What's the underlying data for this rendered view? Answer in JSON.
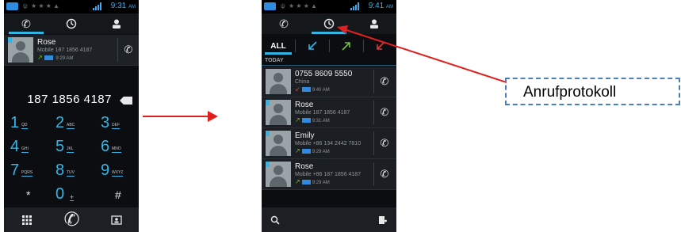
{
  "phone_dialer": {
    "status": {
      "time": "9:31",
      "ampm": "AM"
    },
    "tabs": [
      {
        "icon": "phone-icon",
        "selected": true
      },
      {
        "icon": "clock-icon",
        "selected": false
      },
      {
        "icon": "contacts-icon",
        "selected": false
      }
    ],
    "recent_contact": {
      "name": "Rose",
      "number": "Mobile 187 1856 4187",
      "time": "9:29 AM",
      "direction": "outgoing"
    },
    "dialed_number": "187 1856 4187",
    "keypad": [
      {
        "digit": "1",
        "letters": "QD"
      },
      {
        "digit": "2",
        "letters": "ABC"
      },
      {
        "digit": "3",
        "letters": "DEF"
      },
      {
        "digit": "4",
        "letters": "GHI"
      },
      {
        "digit": "5",
        "letters": "JKL"
      },
      {
        "digit": "6",
        "letters": "MNO"
      },
      {
        "digit": "7",
        "letters": "PQRS"
      },
      {
        "digit": "8",
        "letters": "TUV"
      },
      {
        "digit": "9",
        "letters": "WXYZ"
      },
      {
        "digit": "*",
        "letters": ""
      },
      {
        "digit": "0",
        "letters": "+"
      },
      {
        "digit": "#",
        "letters": ""
      }
    ],
    "bottom_buttons": [
      "dialpad-icon",
      "call-icon",
      "contact-card-icon"
    ]
  },
  "phone_log": {
    "status": {
      "time": "9:41",
      "ampm": "AM"
    },
    "tabs": [
      {
        "icon": "phone-icon",
        "selected": false
      },
      {
        "icon": "clock-icon",
        "selected": true
      },
      {
        "icon": "contacts-icon",
        "selected": false
      }
    ],
    "filters": {
      "all_label": "ALL",
      "icons": [
        "incoming-arrow-icon",
        "outgoing-arrow-icon",
        "missed-arrow-icon"
      ]
    },
    "section_label": "TODAY",
    "entries": [
      {
        "name": "0755 8609 5550",
        "detail": "China",
        "time": "9:40 AM",
        "direction": "missed"
      },
      {
        "name": "Rose",
        "detail": "Mobile 187 1856 4187",
        "time": "9:31 AM",
        "direction": "outgoing"
      },
      {
        "name": "Emily",
        "detail": "Mobile +86 134 2442 7810",
        "time": "9:29 AM",
        "direction": "outgoing"
      },
      {
        "name": "Rose",
        "detail": "Mobile +86 187 1856 4187",
        "time": "9:29 AM",
        "direction": "outgoing"
      }
    ],
    "bottom_buttons": [
      "search-icon",
      "new-entry-icon"
    ]
  },
  "annotation": {
    "label": "Anrufprotokoll"
  },
  "colors": {
    "accent": "#33b5e5",
    "arrow": "#e02020",
    "annotation_border": "#4a7fc0"
  }
}
